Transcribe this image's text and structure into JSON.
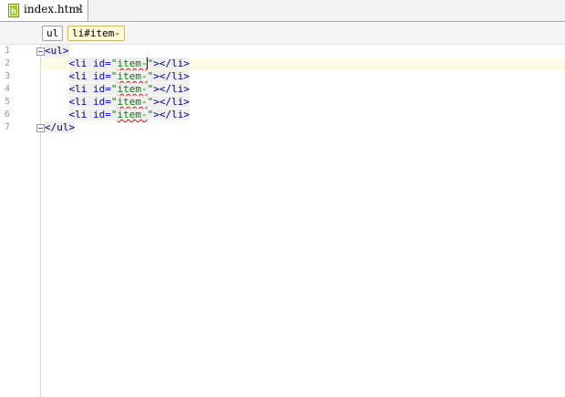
{
  "tab": {
    "title": "index.html",
    "close": "×"
  },
  "breadcrumb": [
    "ul",
    "li#item-"
  ],
  "editor": {
    "line_numbers": [
      "1",
      "2",
      "3",
      "4",
      "5",
      "6",
      "7"
    ],
    "current_line": 2,
    "lines": [
      {
        "indent": "",
        "open": "<ul>"
      },
      {
        "indent": "    ",
        "tag": "<li",
        "attr": " id=",
        "q1": "\"",
        "val": "item-",
        "q2": "\"",
        "rest": "></li>"
      },
      {
        "indent": "    ",
        "tag": "<li",
        "attr": " id=",
        "q1": "\"",
        "val": "item-",
        "q2": "\"",
        "rest": "></li>"
      },
      {
        "indent": "    ",
        "tag": "<li",
        "attr": " id=",
        "q1": "\"",
        "val": "item-",
        "q2": "\"",
        "rest": "></li>"
      },
      {
        "indent": "    ",
        "tag": "<li",
        "attr": " id=",
        "q1": "\"",
        "val": "item-",
        "q2": "\"",
        "rest": "></li>"
      },
      {
        "indent": "    ",
        "tag": "<li",
        "attr": " id=",
        "q1": "\"",
        "val": "item-",
        "q2": "\"",
        "rest": "></li>"
      },
      {
        "indent": "",
        "close": "</ul>"
      }
    ]
  }
}
